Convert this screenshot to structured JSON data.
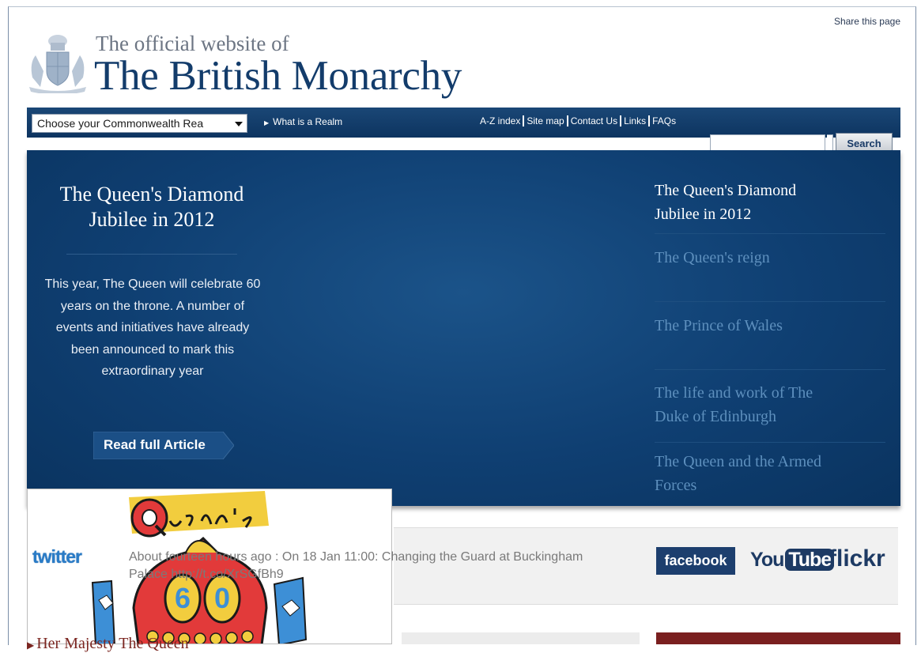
{
  "header": {
    "share_link": "Share this page",
    "logo_line1": "The official website of",
    "logo_line2": "The British Monarchy"
  },
  "nav": {
    "realm_select_value": "Choose your Commonwealth Rea",
    "realm_link": "What is a Realm",
    "links": [
      "A-Z index",
      "Site map",
      "Contact Us",
      "Links",
      "FAQs"
    ],
    "search_button": "Search",
    "search_value": ""
  },
  "hero": {
    "title_line1": "The Queen's Diamond",
    "title_line2": "Jubilee in 2012",
    "text_lines": [
      "This year, The Queen will celebrate 60",
      "years on the throne. A number of",
      "events and initiatives have already",
      "been announced to mark this",
      "extraordinary year"
    ],
    "read_button": "Read full Article"
  },
  "right_menu": [
    {
      "line1": "The Queen's Diamond",
      "line2": "Jubilee in 2012"
    },
    {
      "line1": "The Queen's reign",
      "line2": ""
    },
    {
      "line1": "The Prince of Wales",
      "line2": ""
    },
    {
      "line1": "The life and work of The",
      "line2": "Duke of Edinburgh"
    },
    {
      "line1": "The Queen and the Armed",
      "line2": "Forces"
    }
  ],
  "social": {
    "twitter_logo": "twitter",
    "tweet_line1": "About fourteen hours ago : On 18 Jan 11:00: Changing the Guard at Buckingham",
    "tweet_line2": "Palace http://t.co/XrSGfBh9",
    "facebook": "facebook",
    "youtube_you": "You",
    "youtube_tube": "Tube",
    "flickr": "flickr"
  },
  "popup": {
    "word": "ueen's",
    "initial": "Q",
    "number": "60"
  },
  "bottom": {
    "left_heading": "Her Majesty The Queen"
  },
  "colors": {
    "navy": "#133c6b",
    "hero_blue": "#0f3f72",
    "menu_inactive": "#5d8fbd",
    "maroon": "#7a1f1f"
  }
}
